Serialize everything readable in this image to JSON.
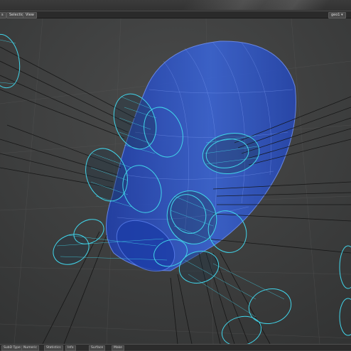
{
  "toolbar": {
    "items": [
      {
        "label": "s"
      },
      {
        "label": "Selection"
      },
      {
        "label": "View"
      }
    ],
    "right_dropdown": "geo1 ▾"
  },
  "viewport": {
    "background": "#3a3b3b",
    "mesh_color": "#2f55c8",
    "wire_color": "#3fd2e8",
    "line_color": "#101010"
  },
  "statusbar": {
    "items": [
      {
        "label": "SubD Type ▾"
      },
      {
        "label": "Numeric"
      },
      {
        "label": "Statistics"
      },
      {
        "label": "Info"
      },
      {
        "label": "Surface"
      },
      {
        "label": "Make"
      }
    ]
  }
}
